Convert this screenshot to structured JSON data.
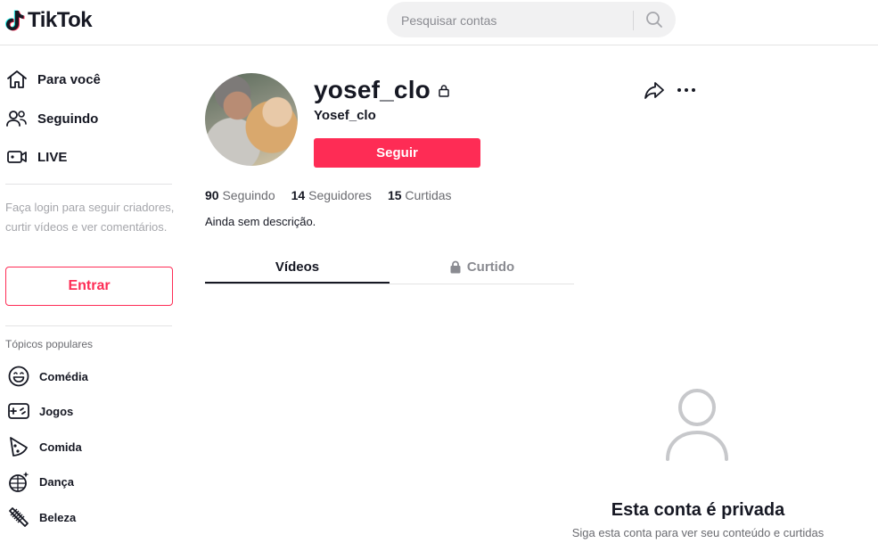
{
  "header": {
    "logo_text": "TikTok",
    "search_placeholder": "Pesquisar contas"
  },
  "sidebar": {
    "nav": [
      {
        "label": "Para você",
        "icon": "home-icon"
      },
      {
        "label": "Seguindo",
        "icon": "following-icon"
      },
      {
        "label": "LIVE",
        "icon": "live-icon"
      }
    ],
    "login_text": "Faça login para seguir criadores, curtir vídeos e ver comentários.",
    "login_button": "Entrar",
    "topics_title": "Tópicos populares",
    "topics": [
      {
        "label": "Comédia",
        "icon": "comedy-icon"
      },
      {
        "label": "Jogos",
        "icon": "gamepad-icon"
      },
      {
        "label": "Comida",
        "icon": "pizza-icon"
      },
      {
        "label": "Dança",
        "icon": "disco-ball-icon"
      },
      {
        "label": "Beleza",
        "icon": "comb-icon"
      }
    ]
  },
  "profile": {
    "username": "yosef_clo",
    "nickname": "Yosef_clo",
    "follow_button": "Seguir",
    "stats": [
      {
        "value": "90",
        "label": "Seguindo"
      },
      {
        "value": "14",
        "label": "Seguidores"
      },
      {
        "value": "15",
        "label": "Curtidas"
      }
    ],
    "bio": "Ainda sem descrição."
  },
  "tabs": [
    {
      "label": "Vídeos",
      "active": true
    },
    {
      "label": "Curtido",
      "active": false,
      "icon": "lock-icon"
    }
  ],
  "private_notice": {
    "title": "Esta conta é privada",
    "subtitle": "Siga esta conta para ver seu conteúdo e curtidas"
  },
  "colors": {
    "accent": "#fe2c55",
    "text": "#161823",
    "muted": "#8a8b91"
  }
}
